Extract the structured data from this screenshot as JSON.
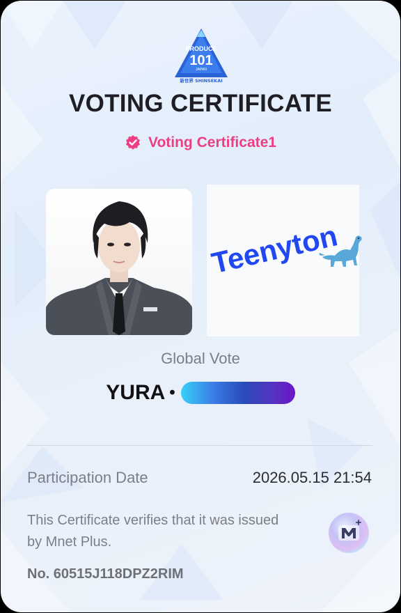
{
  "certificate": {
    "logo": {
      "brand_top": "PRODUCE",
      "brand_number": "101",
      "brand_sub": "JAPAN",
      "brand_tagline": "新世界 SHINSEKAI"
    },
    "title": "VOTING CERTIFICATE",
    "badge_icon": "verified-badge-icon",
    "badge_label": "Voting Certificate1",
    "photo_subject": "contestant-portrait",
    "fan_text": "Teenyton",
    "fan_text_icon": "dinosaur-emoji",
    "vote_type": "Global Vote",
    "candidate_name": "YURA",
    "separator": "•",
    "participation_label": "Participation Date",
    "participation_value": "2026.05.15 21:54",
    "verify_text": "This Certificate verifies that it was issued by Mnet Plus.",
    "mnet_icon": "mnet-plus-logo-icon",
    "cert_number": "No. 60515J118DPZ2RIM"
  },
  "colors": {
    "title": "#1e1e24",
    "badge": "#ec3f83",
    "fan_text": "#2147f0",
    "bar_start": "#3ad0f7",
    "bar_end": "#6c16c6",
    "muted_text": "#7b7e86"
  }
}
